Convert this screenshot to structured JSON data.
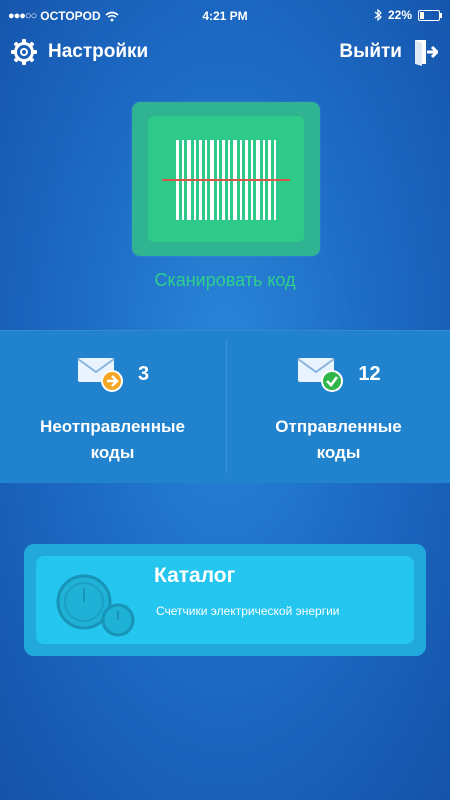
{
  "status": {
    "carrier": "OCTOPOD",
    "time": "4:21 PM",
    "battery": "22%",
    "battery_level": 0.22
  },
  "nav": {
    "settings_label": "Настройки",
    "logout_label": "Выйти"
  },
  "scan": {
    "label": "Сканировать код"
  },
  "codes": {
    "unsent": {
      "count": "3",
      "label_line1": "Неотправленные",
      "label_line2": "коды"
    },
    "sent": {
      "count": "12",
      "label_line1": "Отправленные",
      "label_line2": "коды"
    }
  },
  "catalog": {
    "title": "Каталог",
    "subtitle": "Счетчики электрической энергии"
  },
  "colors": {
    "background": "#1d6cc6",
    "scan_green": "#2fc98a",
    "catalog_cyan": "#24c5ee",
    "badge_orange": "#f5a623",
    "badge_green": "#2fb54a"
  }
}
